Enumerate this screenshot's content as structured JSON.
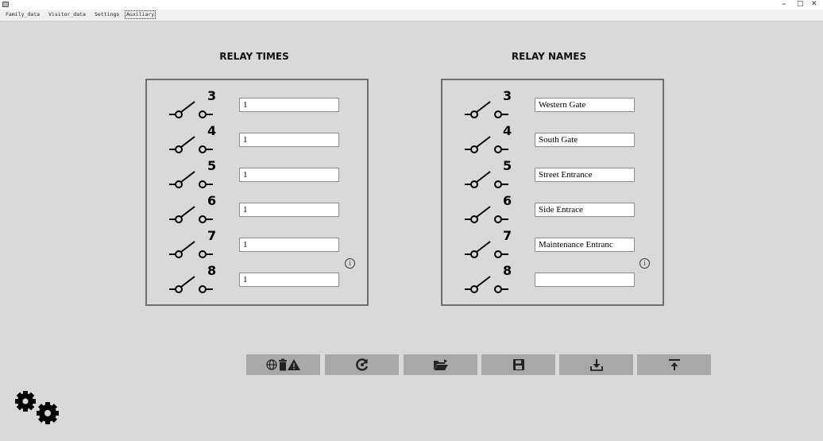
{
  "window": {
    "minimize_glyph": "–",
    "maximize_glyph": "□",
    "close_glyph": "✕"
  },
  "tabs": [
    {
      "label": "Family_data",
      "active": false
    },
    {
      "label": "Visitor_data",
      "active": false
    },
    {
      "label": "Settings",
      "active": false
    },
    {
      "label": "Auxiliary",
      "active": true
    }
  ],
  "relay_times": {
    "title": "RELAY TIMES",
    "rows": [
      {
        "relay": "3",
        "value": "1"
      },
      {
        "relay": "4",
        "value": "1"
      },
      {
        "relay": "5",
        "value": "1"
      },
      {
        "relay": "6",
        "value": "1"
      },
      {
        "relay": "7",
        "value": "1"
      },
      {
        "relay": "8",
        "value": "1"
      }
    ],
    "info_glyph": "i"
  },
  "relay_names": {
    "title": "RELAY NAMES",
    "rows": [
      {
        "relay": "3",
        "value": "Western Gate"
      },
      {
        "relay": "4",
        "value": "South Gate"
      },
      {
        "relay": "5",
        "value": "Street Entrance"
      },
      {
        "relay": "6",
        "value": "Side Entrace"
      },
      {
        "relay": "7",
        "value": "Maintenance Entranc"
      },
      {
        "relay": "8",
        "value": ""
      }
    ],
    "info_glyph": "i"
  },
  "toolbar": {
    "buttons": [
      {
        "name": "clear-all-button",
        "icons": [
          "globe-icon",
          "trash-icon",
          "warning-icon"
        ]
      },
      {
        "name": "refresh-button",
        "icons": [
          "refresh-icon"
        ]
      },
      {
        "name": "open-button",
        "icons": [
          "folder-open-icon"
        ]
      },
      {
        "name": "save-button",
        "icons": [
          "floppy-disk-icon"
        ]
      },
      {
        "name": "download-button",
        "icons": [
          "download-icon"
        ]
      },
      {
        "name": "upload-button",
        "icons": [
          "upload-icon"
        ]
      }
    ]
  },
  "colors": {
    "background": "#d9d9d9",
    "panel_border": "#6e6e6e",
    "toolbar_button": "#a8a8a8"
  }
}
